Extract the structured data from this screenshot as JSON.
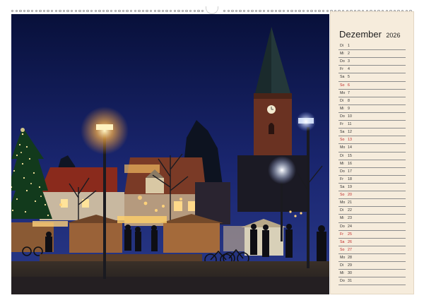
{
  "calendar": {
    "month": "Dezember",
    "year": "2026",
    "days": [
      {
        "wd": "Di",
        "d": "1",
        "we": false
      },
      {
        "wd": "Mi",
        "d": "2",
        "we": false
      },
      {
        "wd": "Do",
        "d": "3",
        "we": false
      },
      {
        "wd": "Fr",
        "d": "4",
        "we": false
      },
      {
        "wd": "Sa",
        "d": "5",
        "we": false
      },
      {
        "wd": "So",
        "d": "6",
        "we": true
      },
      {
        "wd": "Mo",
        "d": "7",
        "we": false
      },
      {
        "wd": "Di",
        "d": "8",
        "we": false
      },
      {
        "wd": "Mi",
        "d": "9",
        "we": false
      },
      {
        "wd": "Do",
        "d": "10",
        "we": false
      },
      {
        "wd": "Fr",
        "d": "11",
        "we": false
      },
      {
        "wd": "Sa",
        "d": "12",
        "we": false
      },
      {
        "wd": "So",
        "d": "13",
        "we": true
      },
      {
        "wd": "Mo",
        "d": "14",
        "we": false
      },
      {
        "wd": "Di",
        "d": "15",
        "we": false
      },
      {
        "wd": "Mi",
        "d": "16",
        "we": false
      },
      {
        "wd": "Do",
        "d": "17",
        "we": false
      },
      {
        "wd": "Fr",
        "d": "18",
        "we": false
      },
      {
        "wd": "Sa",
        "d": "19",
        "we": false
      },
      {
        "wd": "So",
        "d": "20",
        "we": true
      },
      {
        "wd": "Mo",
        "d": "21",
        "we": false
      },
      {
        "wd": "Di",
        "d": "22",
        "we": false
      },
      {
        "wd": "Mi",
        "d": "23",
        "we": false
      },
      {
        "wd": "Do",
        "d": "24",
        "we": false
      },
      {
        "wd": "Fr",
        "d": "25",
        "we": true
      },
      {
        "wd": "Sa",
        "d": "26",
        "we": true
      },
      {
        "wd": "So",
        "d": "27",
        "we": true
      },
      {
        "wd": "Mo",
        "d": "28",
        "we": false
      },
      {
        "wd": "Di",
        "d": "29",
        "we": false
      },
      {
        "wd": "Mi",
        "d": "30",
        "we": false
      },
      {
        "wd": "Do",
        "d": "31",
        "we": false
      }
    ]
  },
  "colors": {
    "panel": "#f6ecdc",
    "holiday_text": "#c02a2a",
    "sky_top": "#0b1140",
    "sky_bottom": "#23307a"
  },
  "photo": {
    "church_clock": "clock-icon"
  }
}
